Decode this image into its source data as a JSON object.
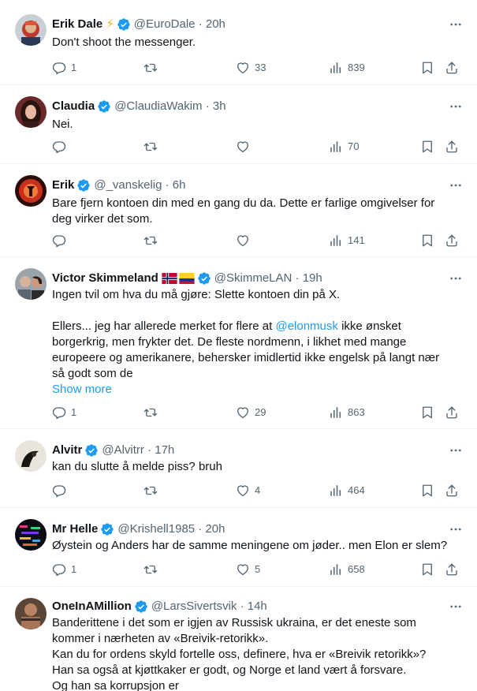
{
  "tweets": [
    {
      "name": "Erik Dale",
      "emoji": "⚡",
      "handle_time": "@EuroDale · 20h",
      "text": [
        "Don't shoot the messenger."
      ],
      "replies": "1",
      "retweets": "",
      "likes": "33",
      "views": "839"
    },
    {
      "name": "Claudia",
      "handle_time": "@ClaudiaWakim · 3h",
      "text": [
        "Nei."
      ],
      "replies": "",
      "retweets": "",
      "likes": "",
      "views": "70"
    },
    {
      "name": "Erik",
      "handle_time": "@_vanskelig · 6h",
      "text": [
        "Bare fjern kontoen din med en gang du da. Dette er farlige omgivelser for",
        "deg virker det som."
      ],
      "replies": "",
      "retweets": "",
      "likes": "",
      "views": "141"
    },
    {
      "name": "Victor Skimmeland",
      "handle_time": "@SkimmeLAN · 19h",
      "text": [
        "Ingen tvil om hva du må gjøre: Slette kontoen din på X."
      ],
      "para2_before": "Ellers... jeg har allerede merket for flere at ",
      "mention": "@elonmusk",
      "para2_after": " ikke ønsket",
      "para2_lines": [
        "borgerkrig, men frykter det. De fleste nordmenn, i likhet med mange",
        "europeere og amerikanere, behersker imidlertid ikke engelsk på langt nær",
        "så godt som de"
      ],
      "show_more": "Show more",
      "replies": "1",
      "retweets": "",
      "likes": "29",
      "views": "863"
    },
    {
      "name": "Alvitr",
      "handle_time": "@Alvitrr · 17h",
      "text": [
        "kan du slutte å melde piss? bruh"
      ],
      "replies": "",
      "retweets": "",
      "likes": "4",
      "views": "464"
    },
    {
      "name": "Mr Helle",
      "handle_time": "@Krishell1985 · 20h",
      "text": [
        "Øystein og Anders har de samme meningene om jøder..  men Elon er slem?"
      ],
      "replies": "1",
      "retweets": "",
      "likes": "5",
      "views": "658"
    },
    {
      "name": "OneInAMillion",
      "handle_time": "@LarsSivertsvik · 14h",
      "text": [
        "Banderittene i det som er igjen av Russisk ukraina, er det eneste som",
        "kommer i nærheten av «Breivik-retorikk».",
        "Kan du for ordens skyld fortelle oss, definere, hva er «Breivik retorikk»?",
        "Han sa også at kjøttkaker er godt, og Norge et land vært å forsvare.",
        "Og han sa korrupsjon er"
      ],
      "replies": "",
      "retweets": "",
      "likes": "",
      "views": ""
    }
  ],
  "icons": {
    "verified": "verified-badge-icon",
    "more": "more-dots-icon",
    "reply": "reply-icon",
    "retweet": "retweet-icon",
    "like": "heart-icon",
    "views": "views-icon",
    "bookmark": "bookmark-icon",
    "share": "share-icon"
  },
  "colors": {
    "accent": "#1d9bf0",
    "muted": "#536471",
    "text": "#0f1419",
    "divider": "#eff3f4",
    "lightning": "#f9b11b"
  }
}
